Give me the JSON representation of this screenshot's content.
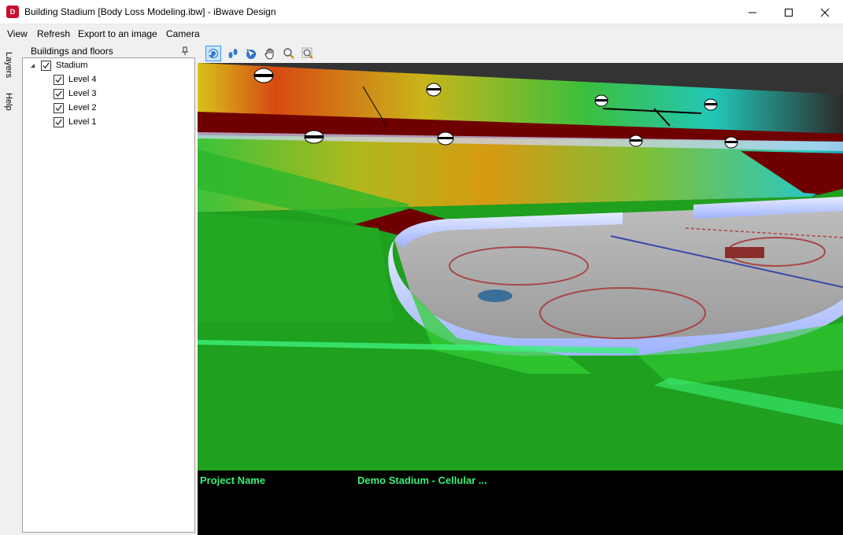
{
  "window": {
    "title": "Building Stadium [Body Loss Modeling.ibw] - iBwave Design",
    "app_icon": "ibwave-logo-icon"
  },
  "menu": [
    "View",
    "Refresh",
    "Export to an image",
    "Camera"
  ],
  "side_tabs": [
    "Layers",
    "Help"
  ],
  "panel": {
    "title": "Buildings and floors",
    "tree": {
      "root": {
        "label": "Stadium",
        "checked": true,
        "expanded": true
      },
      "children": [
        {
          "label": "Level 4",
          "checked": true
        },
        {
          "label": "Level 3",
          "checked": true
        },
        {
          "label": "Level 2",
          "checked": true
        },
        {
          "label": "Level 1",
          "checked": true
        }
      ]
    }
  },
  "toolbar": {
    "tools": [
      "rotate-icon",
      "walk-icon",
      "fly-icon",
      "pan-hand-icon",
      "zoom-icon",
      "zoom-window-icon"
    ],
    "active_tool": "rotate-icon"
  },
  "info": {
    "label": "Project Name",
    "value": "Demo Stadium - Cellular ..."
  },
  "colors": {
    "heatmap_text": "#3cf07a",
    "info_background": "#000000",
    "seat_red": "#6e0000",
    "coverage_green": "#1fa01f"
  }
}
